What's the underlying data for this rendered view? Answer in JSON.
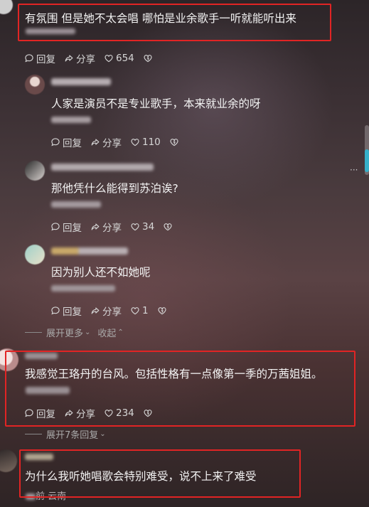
{
  "comments": [
    {
      "text": "有氛围 但是她不太会唱  哪怕是业余歌手一听就能听出来",
      "reply_label": "回复",
      "share_label": "分享",
      "likes": "654"
    },
    {
      "text": "人家是演员不是专业歌手，本来就业余的呀",
      "reply_label": "回复",
      "share_label": "分享",
      "likes": "110"
    },
    {
      "text": "那他凭什么能得到苏泊诶?",
      "reply_label": "回复",
      "share_label": "分享",
      "likes": "34"
    },
    {
      "text": "因为别人还不如她呢",
      "reply_label": "回复",
      "share_label": "分享",
      "likes": "1"
    },
    {
      "text": "我感觉王珞丹的台风。包括性格有一点像第一季的万茜姐姐。",
      "reply_label": "回复",
      "share_label": "分享",
      "likes": "234"
    },
    {
      "text": "为什么我听她唱歌会特别难受，说不上来了难受",
      "meta": "前  云南"
    }
  ],
  "expand1": {
    "more": "展开更多",
    "collapse": "收起"
  },
  "expand2": {
    "more": "展开7条回复"
  },
  "colors": {
    "highlight": "#e12424",
    "scroll_thumb": "#36b0c9",
    "text": "#f3f3f3"
  },
  "icons": [
    "comment-icon",
    "share-icon",
    "heart-icon",
    "dislike-icon",
    "chevron-down-icon",
    "chevron-up-icon"
  ]
}
